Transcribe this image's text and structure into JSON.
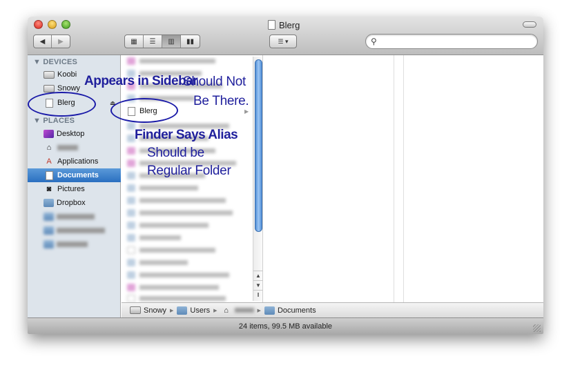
{
  "window": {
    "title": "Blerg",
    "status": "24 items, 99.5 MB available"
  },
  "toolbar": {
    "back_icon": "back-arrow-icon",
    "forward_icon": "forward-arrow-icon",
    "views": [
      "icon-view-icon",
      "list-view-icon",
      "column-view-icon",
      "cover-flow-icon"
    ],
    "active_view": "column",
    "search": {
      "value": "",
      "placeholder": ""
    }
  },
  "sidebar": {
    "devices_heading": "DEVICES",
    "devices": [
      {
        "label": "Koobi",
        "icon": "computer-icon"
      },
      {
        "label": "Snowy",
        "icon": "drive-icon"
      },
      {
        "label": "Blerg",
        "icon": "document-icon"
      }
    ],
    "places_heading": "PLACES",
    "places": [
      {
        "label": "Desktop",
        "icon": "desktop-icon"
      },
      {
        "label": "",
        "icon": "home-icon"
      },
      {
        "label": "Applications",
        "icon": "applications-icon"
      },
      {
        "label": "Documents",
        "icon": "documents-icon",
        "selected": true
      },
      {
        "label": "Pictures",
        "icon": "pictures-icon"
      },
      {
        "label": "Dropbox",
        "icon": "folder-icon"
      }
    ]
  },
  "column1": {
    "selected_item": "Blerg"
  },
  "pathbar": {
    "crumbs": [
      "Snowy",
      "Users",
      "",
      "Documents"
    ]
  },
  "annotations": {
    "sidebar_note": "Appears in Sidebar",
    "should_not_1": "Should Not",
    "should_not_2": "Be There.",
    "alias_note": "Finder Says Alias",
    "should_be_1": "Should be",
    "should_be_2": "Regular Folder",
    "color": "#1f1f9c"
  }
}
